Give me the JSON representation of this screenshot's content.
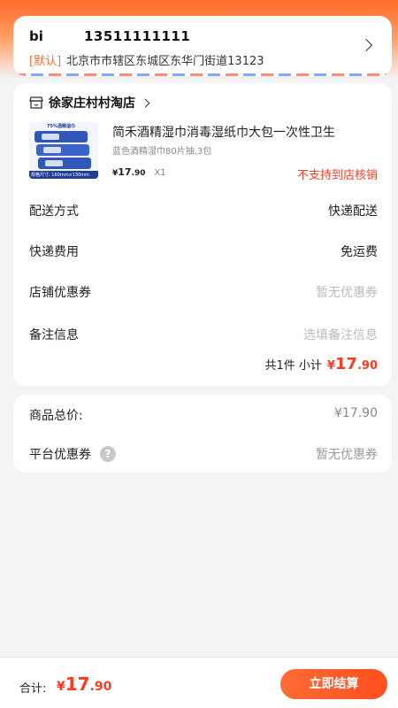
{
  "address": {
    "name": "bi",
    "phone": "13511111111",
    "default_tag": "[默认]",
    "detail": "北京市市辖区东城区东华门街道13123"
  },
  "store": {
    "name": "徐家庄村村淘店",
    "product": {
      "title": "简禾酒精湿巾消毒湿纸巾大包一次性卫生",
      "spec": "蓝色酒精湿巾80片抽,3包",
      "price_currency": "¥",
      "price_int": "17",
      "price_dec": ".90",
      "qty": "X1",
      "note": "不支持到店核销",
      "img_text_top": "75%酒精湿巾",
      "img_text_bottom": "规格尺寸: 160mm×130mm"
    },
    "rows": [
      {
        "label": "配送方式",
        "value": "快递配送"
      },
      {
        "label": "快递费用",
        "value": "免运费"
      },
      {
        "label": "店铺优惠券",
        "value": "暂无优惠券"
      },
      {
        "label": "备注信息",
        "value": "选填备注信息"
      }
    ],
    "subtotal_label": "共1件 小计",
    "subtotal_currency": "¥",
    "subtotal_int": "17",
    "subtotal_dec": ".90"
  },
  "summary": {
    "goods_total_label": "商品总价:",
    "goods_total_value": "¥17.90",
    "platform_coupon_label": "平台优惠券",
    "help_glyph": "?",
    "platform_coupon_value": "暂无优惠券"
  },
  "bottom": {
    "total_label": "合计:",
    "total_currency": "¥",
    "total_int": "17",
    "total_dec": ".90",
    "submit_label": "立即结算"
  },
  "colors": {
    "accent": "#ff3b1f",
    "brand_orange": "#ff6a2a"
  }
}
